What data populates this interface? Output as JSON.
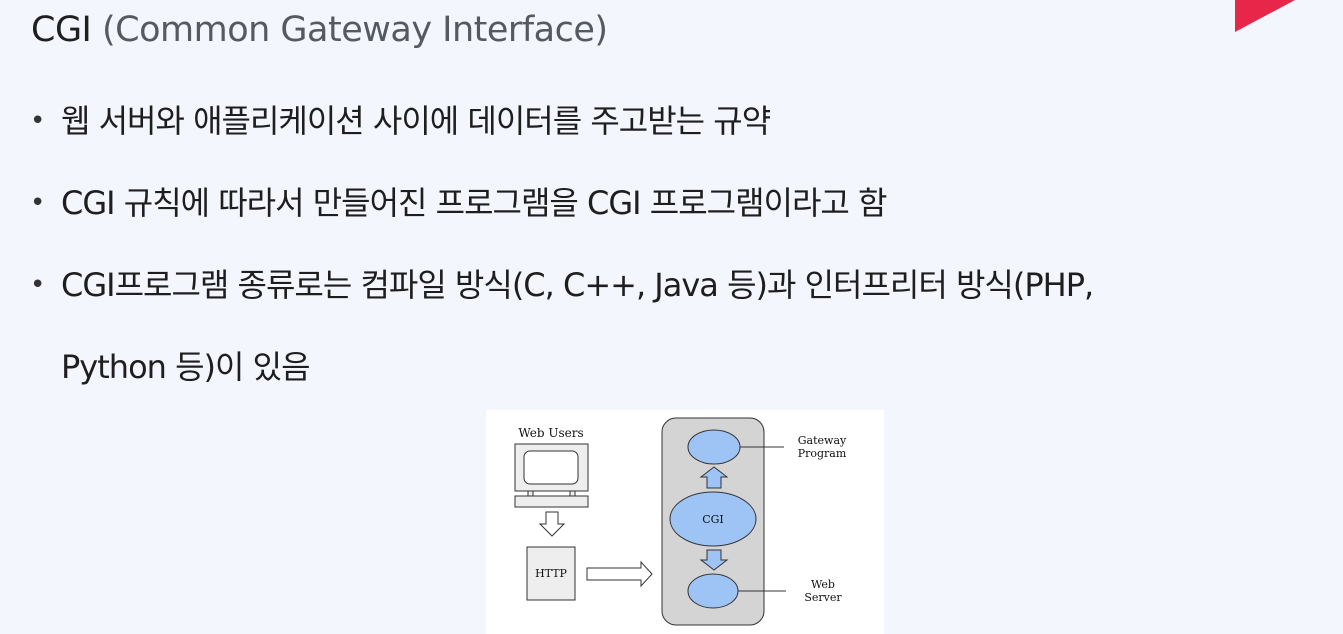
{
  "slide": {
    "title_main": "CGI ",
    "title_sub": "(Common Gateway Interface)",
    "bullets": [
      "웹 서버와 애플리케이션 사이에 데이터를 주고받는 규약",
      "CGI 규칙에 따라서 만들어진 프로그램을 CGI 프로그램이라고 함"
    ],
    "bullet3_line1": "CGI프로그램 종류로는 컴파일 방식(C, C++, Java 등)과 인터프리터 방식(PHP,",
    "bullet3_line2": "Python 등)이 있음",
    "bullet_symbol": "•"
  },
  "diagram": {
    "web_users_label": "Web Users",
    "http_label": "HTTP",
    "cgi_label": "CGI",
    "gateway_label_line1": "Gateway",
    "gateway_label_line2": "Program",
    "server_label_line1": "Web",
    "server_label_line2": "Server"
  },
  "colors": {
    "accent_red": "#e8264a",
    "ellipse_fill": "#9ec3f5",
    "panel_fill": "#d4d4d4",
    "background": "#f3f6fd"
  }
}
